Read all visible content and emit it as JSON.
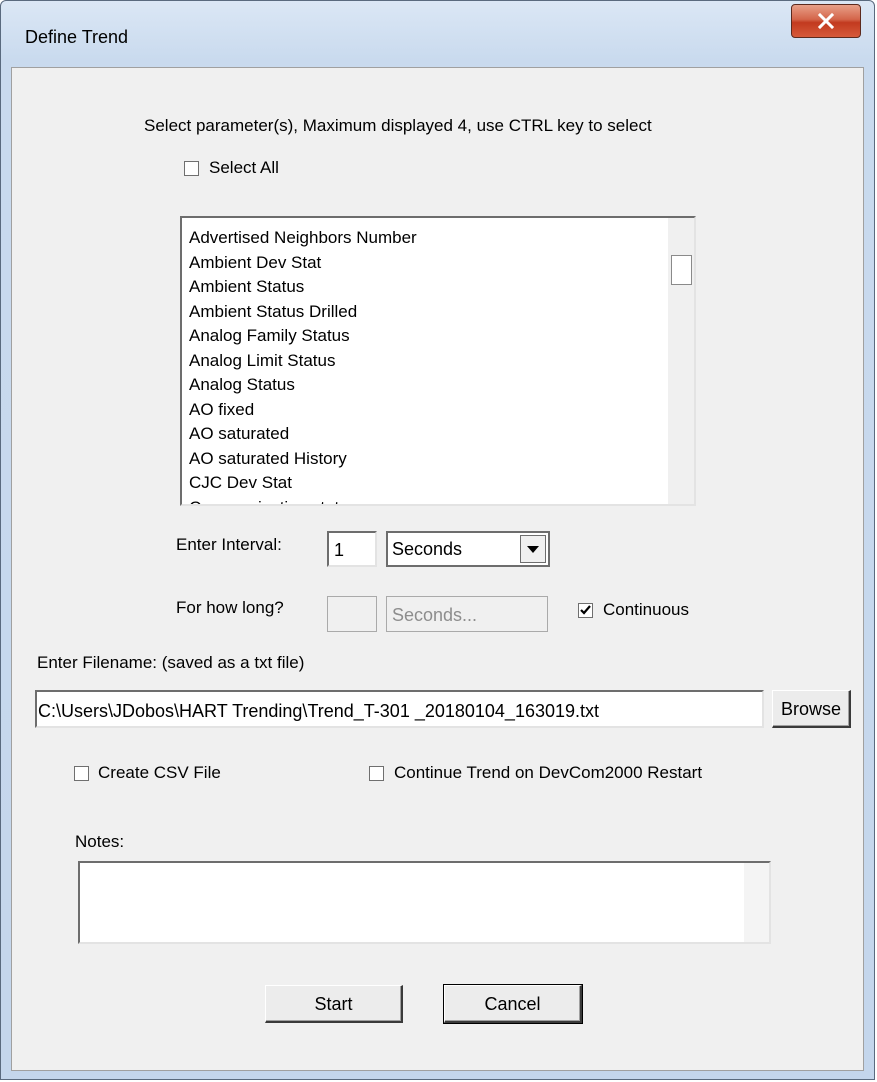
{
  "window": {
    "title": "Define Trend"
  },
  "instructions": "Select parameter(s), Maximum displayed 4, use CTRL key to select",
  "select_all": {
    "label": "Select All",
    "checked": false
  },
  "parameters": {
    "items": [
      "Advertised Neighbors Number",
      "Ambient Dev Stat",
      "Ambient Status",
      "Ambient Status Drilled",
      "Analog Family Status",
      "Analog Limit Status",
      "Analog Status",
      "AO fixed",
      "AO saturated",
      "AO saturated History",
      "CJC Dev Stat",
      "Communication status"
    ]
  },
  "interval": {
    "label": "Enter Interval:",
    "value": "1",
    "unit": "Seconds"
  },
  "duration": {
    "label": "For how long?",
    "value": "",
    "unit": "Seconds...",
    "continuous_label": "Continuous",
    "continuous_checked": true
  },
  "filename": {
    "label": "Enter Filename: (saved as a txt file)",
    "value": "C:\\Users\\JDobos\\HART Trending\\Trend_T-301    _20180104_163019.txt",
    "browse_label": "Browse"
  },
  "options": {
    "csv_label": "Create CSV File",
    "csv_checked": false,
    "restart_label": "Continue Trend on DevCom2000 Restart",
    "restart_checked": false
  },
  "notes": {
    "label": "Notes:",
    "value": ""
  },
  "buttons": {
    "start": "Start",
    "cancel": "Cancel"
  }
}
